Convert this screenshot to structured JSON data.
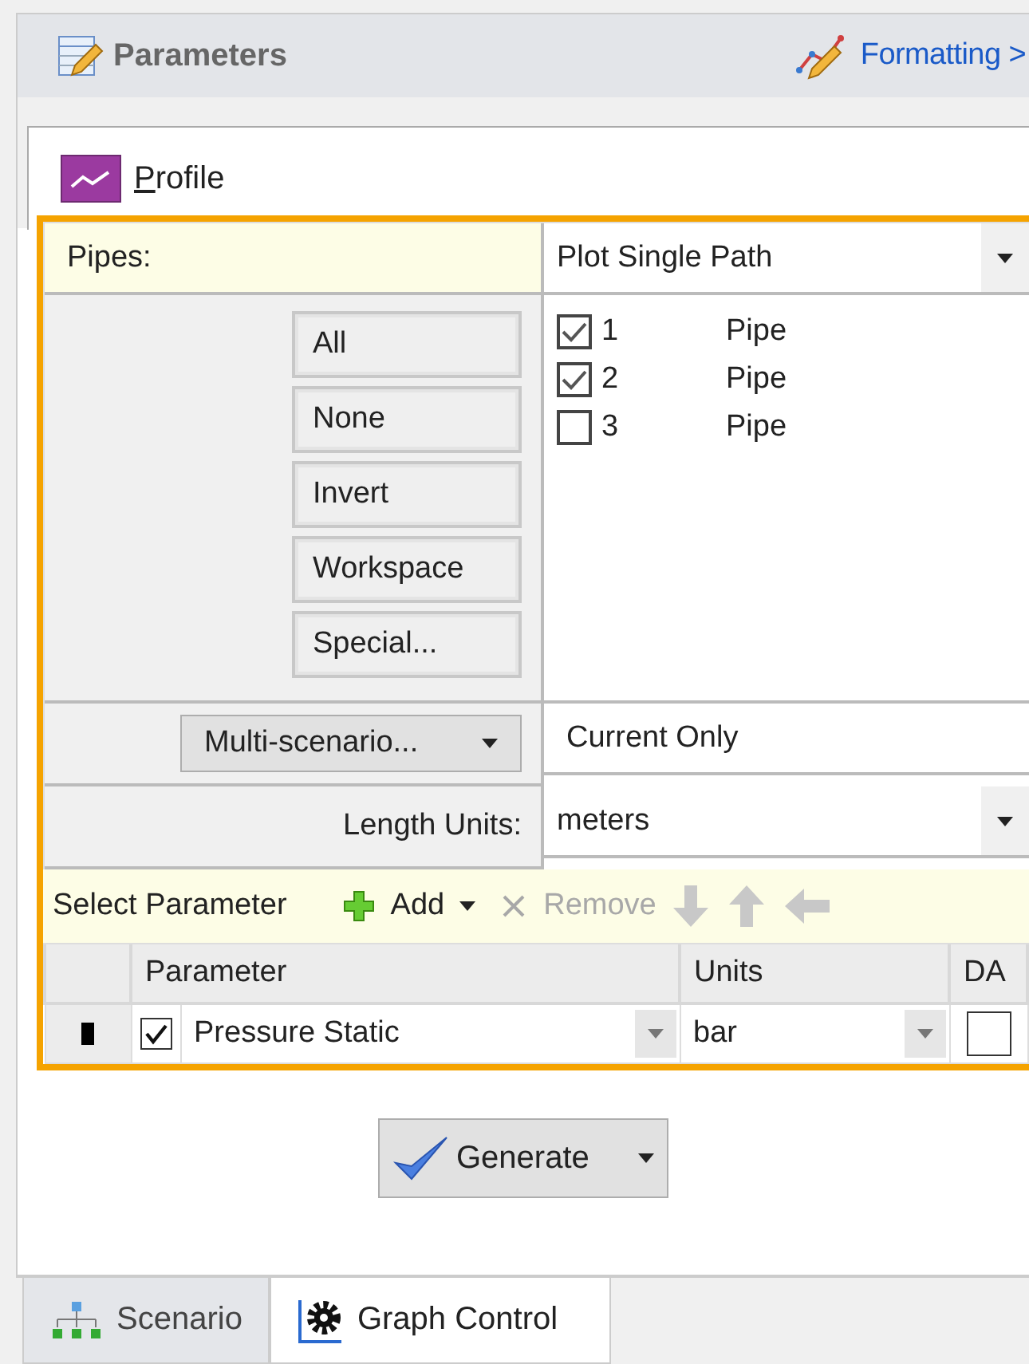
{
  "header": {
    "title": "Parameters",
    "formatting_link": "Formatting >"
  },
  "profile_tab": {
    "label": "Profile"
  },
  "pipes": {
    "label": "Pipes:",
    "mode": "Plot Single Path",
    "buttons": [
      "All",
      "None",
      "Invert",
      "Workspace",
      "Special..."
    ],
    "items": [
      {
        "number": "1",
        "type": "Pipe",
        "checked": true
      },
      {
        "number": "2",
        "type": "Pipe",
        "checked": true
      },
      {
        "number": "3",
        "type": "Pipe",
        "checked": false
      }
    ]
  },
  "scenario": {
    "button": "Multi-scenario...",
    "value": "Current Only"
  },
  "length_units": {
    "label": "Length Units:",
    "value": "meters"
  },
  "toolbar": {
    "title": "Select Parameter",
    "add": {
      "label": "Add",
      "disabled": false
    },
    "remove": {
      "label": "Remove",
      "disabled": true
    }
  },
  "table": {
    "columns": [
      "Parameter",
      "Units",
      "DA"
    ],
    "rows": [
      {
        "checked": true,
        "parameter": "Pressure Static",
        "units": "bar",
        "da": false
      }
    ]
  },
  "generate": "Generate",
  "bottom_tabs": [
    {
      "label": "Scenario",
      "selected": false
    },
    {
      "label": "Graph Control",
      "selected": true
    }
  ]
}
